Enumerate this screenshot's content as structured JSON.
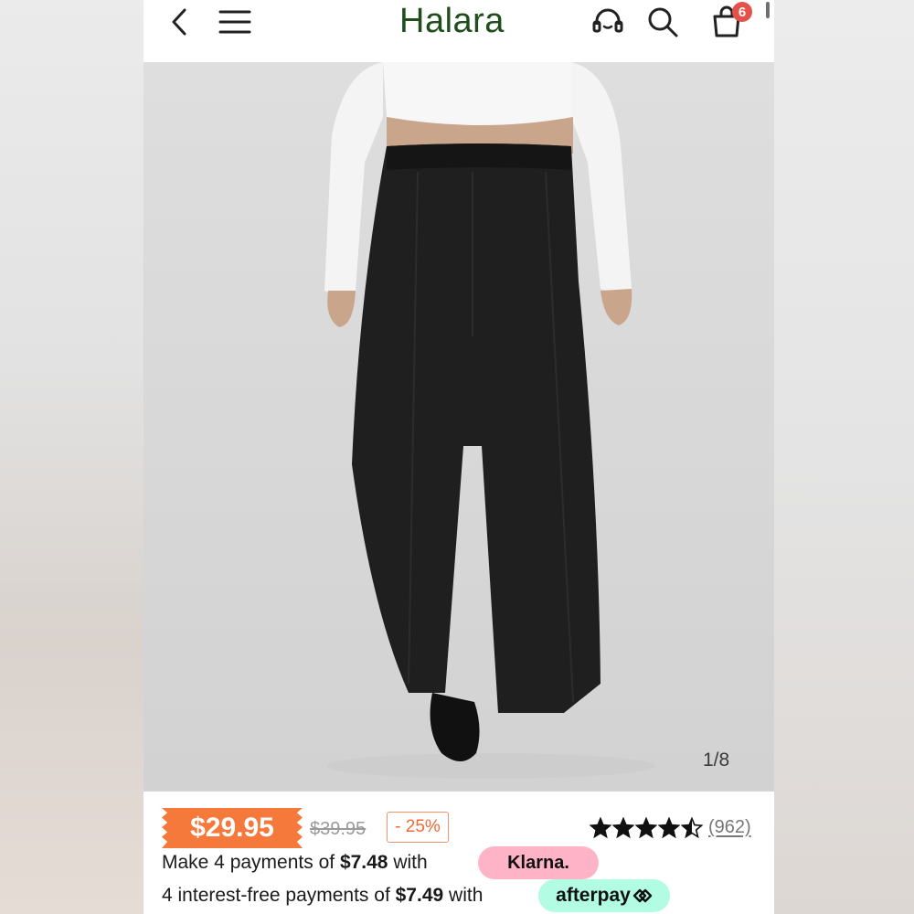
{
  "header": {
    "logo": "Halara",
    "cart_count": "6",
    "icons": [
      "back-arrow-icon",
      "menu-icon",
      "headset-support-icon",
      "search-icon",
      "shopping-bag-icon"
    ]
  },
  "gallery": {
    "counter": "1/8",
    "image_description_icon": "product-photo"
  },
  "pricing": {
    "price": "$29.95",
    "original_price": "$39.95",
    "discount": "- 25%",
    "rating_stars": 4.5,
    "rating_max": 5,
    "review_count": "(962)"
  },
  "payments": {
    "klarna": {
      "prefix": "Make 4 payments of ",
      "amount": "$7.48",
      "suffix": " with",
      "provider": "Klarna."
    },
    "afterpay": {
      "prefix": "4 interest-free payments of ",
      "amount": "$7.49",
      "suffix": " with",
      "provider": "afterpay"
    }
  },
  "colors": {
    "brand": "#1f4d1c",
    "price_tag": "#f5793a",
    "badge": "#e4514a",
    "klarna": "#ffb3c7",
    "afterpay": "#b2fce4"
  }
}
